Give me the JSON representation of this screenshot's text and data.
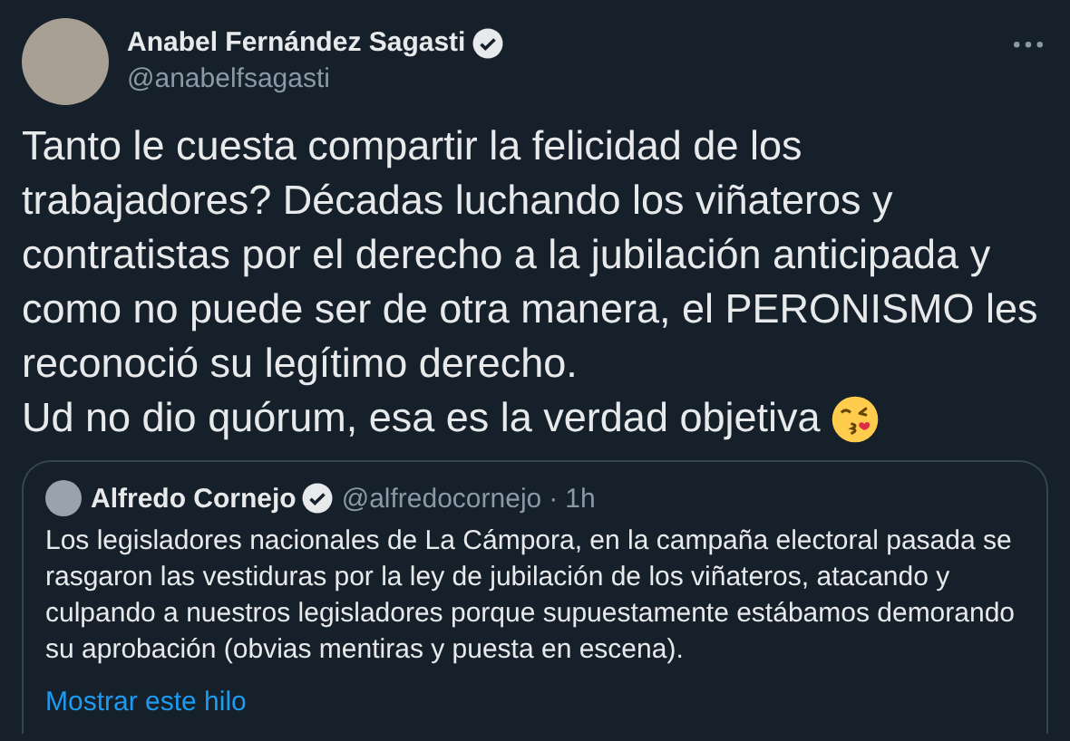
{
  "author": {
    "name": "Anabel Fernández Sagasti",
    "verified": true,
    "handle": "@anabelfsagasti"
  },
  "body": [
    "Tanto le cuesta compartir la felicidad de los trabajadores? Décadas luchando los viñateros y contratistas por el derecho a la jubilación anticipada y como no puede ser de otra manera, el PERONISMO les reconoció su legítimo derecho.",
    "Ud no dio quórum, esa es la verdad objetiva"
  ],
  "quoted": {
    "name": "Alfredo Cornejo",
    "verified": true,
    "handle": "@alfredocornejo",
    "separator": "·",
    "time": "1h",
    "text": "Los legisladores nacionales de La Cámpora, en la campaña electoral pasada se rasgaron las vestiduras por la ley de jubilación de los viñateros, atacando y culpando a nuestros legisladores porque supuestamente estábamos demorando su aprobación (obvias mentiras y puesta en escena).",
    "link": "Mostrar este hilo"
  }
}
